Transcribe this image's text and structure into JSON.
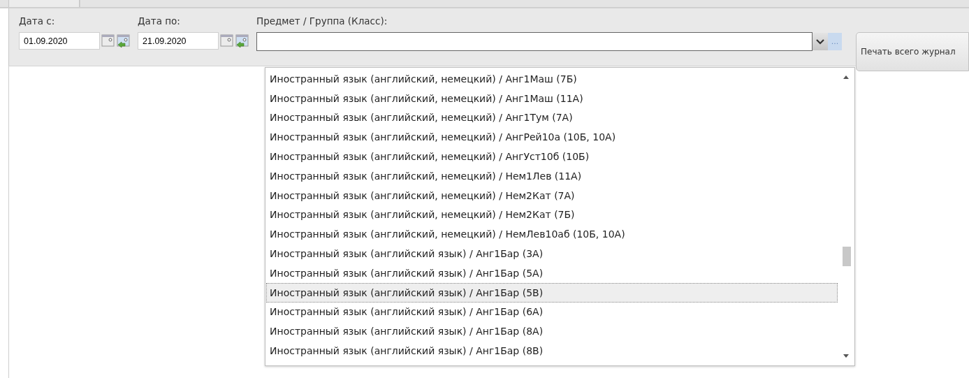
{
  "filters": {
    "date_from": {
      "label": "Дата с:",
      "value": "01.09.2020"
    },
    "date_to": {
      "label": "Дата по:",
      "value": "21.09.2020"
    },
    "subject": {
      "label": "Предмет / Группа (Класс):",
      "expanded": true,
      "ellipsis": "..."
    },
    "print_button": "Печать всего журнал"
  },
  "dropdown": {
    "items": [
      {
        "label": "Иностранный язык (английский, немецкий) / Анг1Маш (7Б)",
        "selected": false
      },
      {
        "label": "Иностранный язык (английский, немецкий) / Анг1Маш (11А)",
        "selected": false
      },
      {
        "label": "Иностранный язык (английский, немецкий) / Анг1Тум (7А)",
        "selected": false
      },
      {
        "label": "Иностранный язык (английский, немецкий) / АнгРей10а (10Б, 10А)",
        "selected": false
      },
      {
        "label": "Иностранный язык (английский, немецкий) / АнгУст10б (10Б)",
        "selected": false
      },
      {
        "label": "Иностранный язык (английский, немецкий) / Нем1Лев (11А)",
        "selected": false
      },
      {
        "label": "Иностранный язык (английский, немецкий) / Нем2Кат (7А)",
        "selected": false
      },
      {
        "label": "Иностранный язык (английский, немецкий) / Нем2Кат (7Б)",
        "selected": false
      },
      {
        "label": "Иностранный язык (английский, немецкий) / НемЛев10аб (10Б, 10А)",
        "selected": false
      },
      {
        "label": "Иностранный язык (английский язык) / Анг1Бар (3А)",
        "selected": false
      },
      {
        "label": "Иностранный язык (английский язык) / Анг1Бар (5А)",
        "selected": false
      },
      {
        "label": "Иностранный язык (английский язык) / Анг1Бар (5В)",
        "selected": true
      },
      {
        "label": "Иностранный язык (английский язык) / Анг1Бар (6А)",
        "selected": false
      },
      {
        "label": "Иностранный язык (английский язык) / Анг1Бар (8А)",
        "selected": false
      },
      {
        "label": "Иностранный язык (английский язык) / Анг1Бар (8В)",
        "selected": false
      }
    ]
  }
}
